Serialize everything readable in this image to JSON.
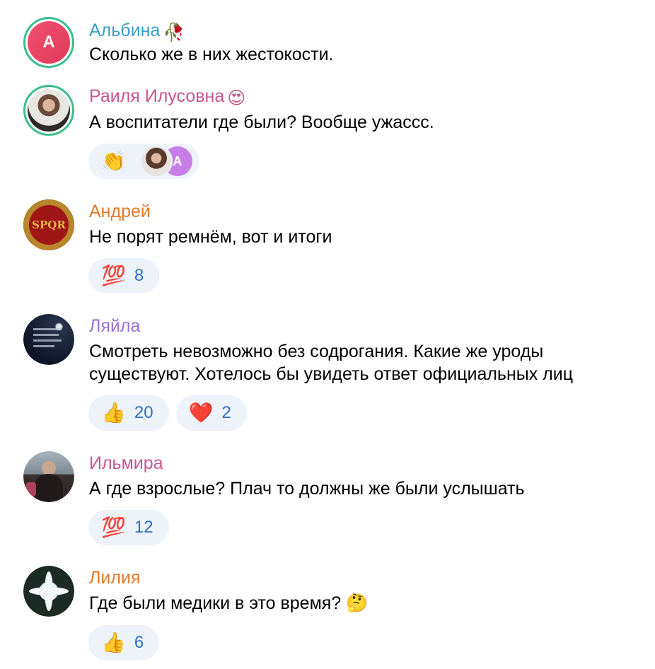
{
  "comments": [
    {
      "name": "Альбина",
      "name_color": "#3a9fc7",
      "name_emoji": "🥀",
      "avatar_letter": "А",
      "text": "Сколько же в них жестокости.",
      "reactions": []
    },
    {
      "name": "Раиля Илусовна",
      "name_color": "#c9558f",
      "name_emoji": "😍",
      "text": "А воспитатели где были? Вообще ужассс.",
      "reactions": [
        {
          "emoji": "👏",
          "avatar_letter": "А"
        }
      ]
    },
    {
      "name": "Андрей",
      "name_color": "#e07b2e",
      "avatar_text": "SPQR",
      "text": "Не порят ремнём, вот и итоги",
      "reactions": [
        {
          "emoji": "💯",
          "count": "8"
        }
      ]
    },
    {
      "name": "Ляйла",
      "name_color": "#9c6fd6",
      "text": "Смотреть невозможно без содрогания. Какие же уроды существуют. Хотелось бы увидеть ответ официальных лиц",
      "reactions": [
        {
          "emoji": "👍",
          "count": "20"
        },
        {
          "emoji": "❤️",
          "count": "2"
        }
      ]
    },
    {
      "name": "Ильмира",
      "name_color": "#c9558f",
      "text": "А где взрослые? Плач то должны же были услышать",
      "reactions": [
        {
          "emoji": "💯",
          "count": "12"
        }
      ]
    },
    {
      "name": "Лилия",
      "name_color": "#e07b2e",
      "text": "Где были медики в это время? 🤔",
      "reactions": [
        {
          "emoji": "👍",
          "count": "6"
        }
      ]
    }
  ]
}
